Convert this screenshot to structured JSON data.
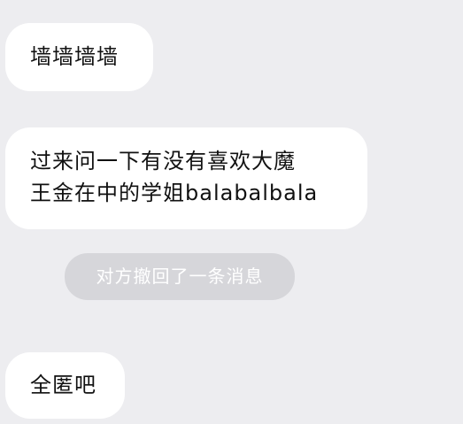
{
  "messages": [
    {
      "sender": "other",
      "text": "墙墙墙墙"
    },
    {
      "sender": "other",
      "lines": [
        "过来问一下有没有喜欢大魔",
        "王金在中的学姐balabalbala"
      ]
    },
    {
      "sender": "other",
      "text": "全匿吧"
    }
  ],
  "system_notice": "对方撤回了一条消息",
  "colors": {
    "background": "#ededf0",
    "bubble": "#ffffff",
    "notice_pill": "#d6d6da",
    "notice_text": "#ffffff"
  }
}
